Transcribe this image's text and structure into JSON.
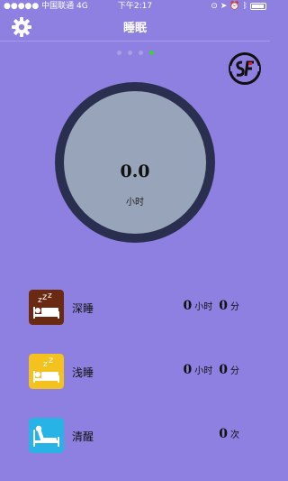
{
  "status_bar": {
    "carrier": "●●●●● 中国联通 4G",
    "time": "下午2:17",
    "icons": [
      "lock-rotation-icon",
      "location-icon",
      "alarm-icon",
      "bluetooth-icon",
      "battery-icon"
    ]
  },
  "header": {
    "title": "睡眠"
  },
  "pager": {
    "count": 4,
    "active_index": 3
  },
  "summary": {
    "value": "0.0",
    "unit": "小时"
  },
  "items": [
    {
      "label": "深睡",
      "hours": "0",
      "hours_unit": "小时",
      "minutes": "0",
      "minutes_unit": "分",
      "icon": "deep-sleep-icon",
      "icon_color": "#6a2a12"
    },
    {
      "label": "浅睡",
      "hours": "0",
      "hours_unit": "小时",
      "minutes": "0",
      "minutes_unit": "分",
      "icon": "light-sleep-icon",
      "icon_color": "#f3c21f"
    },
    {
      "label": "清醒",
      "count": "0",
      "count_unit": "次",
      "icon": "awake-icon",
      "icon_color": "#27b3e6"
    }
  ],
  "colors": {
    "background": "#8d80e0",
    "ring": "#2b2f4f",
    "disc": "#97a4b9",
    "pager_active": "#3ad13a"
  }
}
